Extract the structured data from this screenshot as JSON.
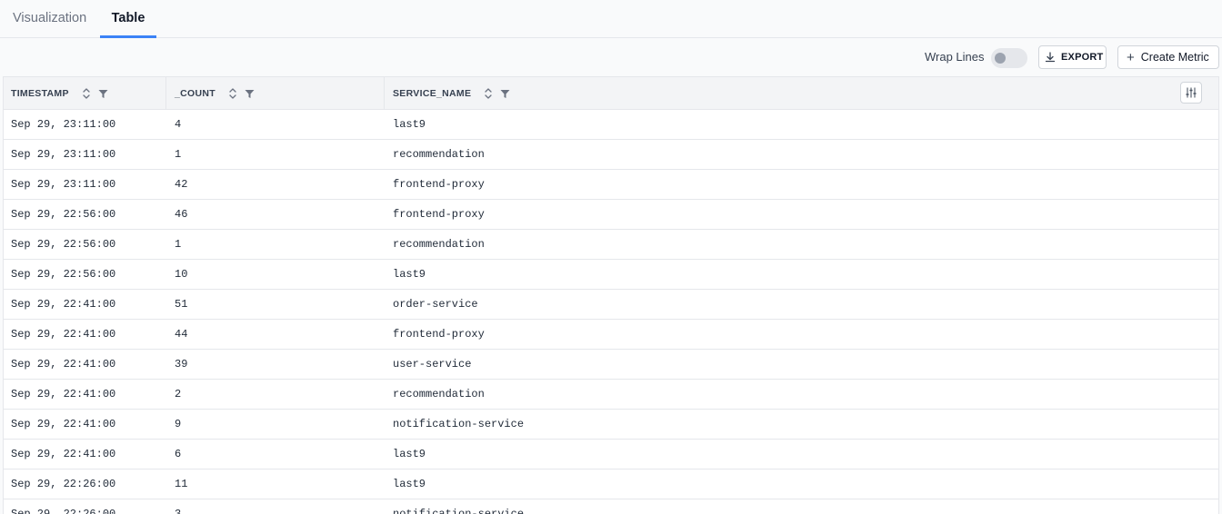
{
  "tabs": [
    {
      "label": "Visualization",
      "active": false
    },
    {
      "label": "Table",
      "active": true
    }
  ],
  "toolbar": {
    "wrap_lines_label": "Wrap Lines",
    "wrap_lines_on": false,
    "export_label": "EXPORT",
    "create_metric_label": "Create Metric"
  },
  "table": {
    "columns": [
      "TIMESTAMP",
      "_COUNT",
      "SERVICE_NAME"
    ],
    "rows": [
      [
        "Sep 29, 23:11:00",
        "4",
        "last9"
      ],
      [
        "Sep 29, 23:11:00",
        "1",
        "recommendation"
      ],
      [
        "Sep 29, 23:11:00",
        "42",
        "frontend-proxy"
      ],
      [
        "Sep 29, 22:56:00",
        "46",
        "frontend-proxy"
      ],
      [
        "Sep 29, 22:56:00",
        "1",
        "recommendation"
      ],
      [
        "Sep 29, 22:56:00",
        "10",
        "last9"
      ],
      [
        "Sep 29, 22:41:00",
        "51",
        "order-service"
      ],
      [
        "Sep 29, 22:41:00",
        "44",
        "frontend-proxy"
      ],
      [
        "Sep 29, 22:41:00",
        "39",
        "user-service"
      ],
      [
        "Sep 29, 22:41:00",
        "2",
        "recommendation"
      ],
      [
        "Sep 29, 22:41:00",
        "9",
        "notification-service"
      ],
      [
        "Sep 29, 22:41:00",
        "6",
        "last9"
      ],
      [
        "Sep 29, 22:26:00",
        "11",
        "last9"
      ],
      [
        "Sep 29, 22:26:00",
        "3",
        "notification-service"
      ]
    ]
  },
  "colors": {
    "accent": "#3b82f6",
    "border": "#e5e7eb",
    "header_bg": "#f3f4f6",
    "page_bg": "#f9fafb"
  },
  "icons": {
    "export": "download-icon",
    "create_metric": "plus-icon",
    "sort": "sort-icon",
    "filter": "filter-icon",
    "column_settings": "sliders-icon"
  }
}
